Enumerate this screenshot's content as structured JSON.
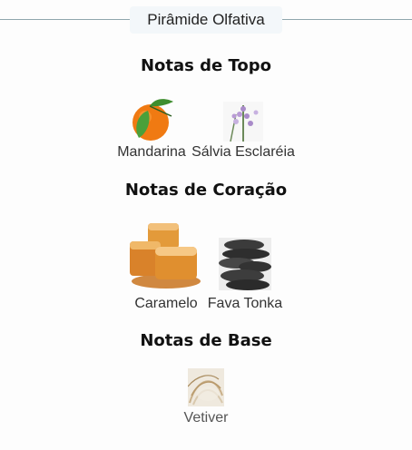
{
  "header": {
    "title": "Pirâmide Olfativa"
  },
  "sections": [
    {
      "heading": "Notas de Topo",
      "notes": [
        {
          "label": "Mandarina",
          "icon": "mandarin-icon"
        },
        {
          "label": "Sálvia Esclaréia",
          "icon": "clary-sage-icon"
        }
      ]
    },
    {
      "heading": "Notas de Coração",
      "notes": [
        {
          "label": "Caramelo",
          "icon": "caramel-icon"
        },
        {
          "label": "Fava Tonka",
          "icon": "tonka-bean-icon"
        }
      ]
    },
    {
      "heading": "Notas de Base",
      "notes": [
        {
          "label": "Vetiver",
          "icon": "vetiver-icon"
        }
      ]
    }
  ],
  "colors": {
    "header_line": "#8fa6ad",
    "header_bg": "#f3f7fa",
    "mandarin": "#f07a12",
    "leaf": "#3f8e2f",
    "caramel": "#d98a2c",
    "tonka": "#3b3b3b",
    "sage": "#a98bc9",
    "vetiver": "#d8c8ad"
  }
}
